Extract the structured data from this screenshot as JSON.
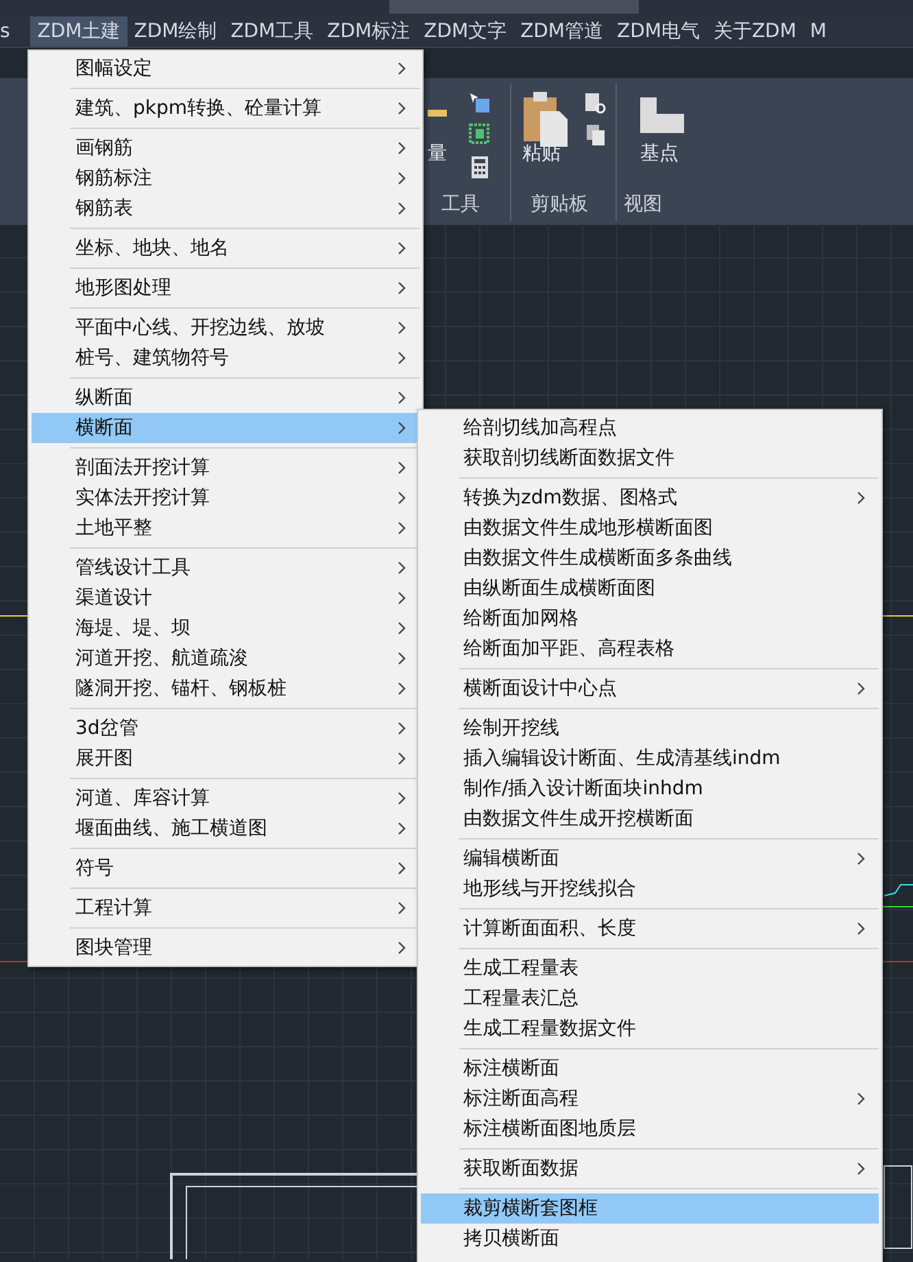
{
  "menu_bar": [
    {
      "label": "s",
      "selected": false
    },
    {
      "label": "ZDM土建",
      "selected": true
    },
    {
      "label": "ZDM绘制",
      "selected": false
    },
    {
      "label": "ZDM工具",
      "selected": false
    },
    {
      "label": "ZDM标注",
      "selected": false
    },
    {
      "label": "ZDM文字",
      "selected": false
    },
    {
      "label": "ZDM管道",
      "selected": false
    },
    {
      "label": "ZDM电气",
      "selected": false
    },
    {
      "label": "关于ZDM",
      "selected": false
    },
    {
      "label": "M",
      "selected": false
    }
  ],
  "ribbon": {
    "labels": [
      {
        "kind": "tool",
        "text": "量"
      },
      {
        "kind": "tool",
        "text": "粘贴"
      },
      {
        "kind": "tool",
        "text": "基点"
      },
      {
        "kind": "panel",
        "text": "工具"
      },
      {
        "kind": "panel",
        "text": "剪贴板"
      },
      {
        "kind": "panel",
        "text": "视图"
      }
    ]
  },
  "dropdown": {
    "groups": [
      {
        "items": [
          {
            "label": "图幅设定",
            "selected": false,
            "has_submenu": true
          }
        ]
      },
      {
        "items": [
          {
            "label": "建筑、pkpm转换、砼量计算",
            "selected": false,
            "has_submenu": true
          }
        ]
      },
      {
        "items": [
          {
            "label": "画钢筋",
            "selected": false,
            "has_submenu": true
          },
          {
            "label": "钢筋标注",
            "selected": false,
            "has_submenu": true
          },
          {
            "label": "钢筋表",
            "selected": false,
            "has_submenu": true
          }
        ]
      },
      {
        "items": [
          {
            "label": "坐标、地块、地名",
            "selected": false,
            "has_submenu": true
          }
        ]
      },
      {
        "items": [
          {
            "label": "地形图处理",
            "selected": false,
            "has_submenu": true
          }
        ]
      },
      {
        "items": [
          {
            "label": "平面中心线、开挖边线、放坡",
            "selected": false,
            "has_submenu": true
          },
          {
            "label": "桩号、建筑物符号",
            "selected": false,
            "has_submenu": true
          }
        ]
      },
      {
        "items": [
          {
            "label": "纵断面",
            "selected": false,
            "has_submenu": true
          },
          {
            "label": "横断面",
            "selected": true,
            "has_submenu": true
          }
        ]
      },
      {
        "items": [
          {
            "label": "剖面法开挖计算",
            "selected": false,
            "has_submenu": true
          },
          {
            "label": "实体法开挖计算",
            "selected": false,
            "has_submenu": true
          },
          {
            "label": "土地平整",
            "selected": false,
            "has_submenu": true
          }
        ]
      },
      {
        "items": [
          {
            "label": "管线设计工具",
            "selected": false,
            "has_submenu": true
          },
          {
            "label": "渠道设计",
            "selected": false,
            "has_submenu": true
          },
          {
            "label": "海堤、堤、坝",
            "selected": false,
            "has_submenu": true
          },
          {
            "label": "河道开挖、航道疏浚",
            "selected": false,
            "has_submenu": true
          },
          {
            "label": "隧洞开挖、锚杆、钢板桩",
            "selected": false,
            "has_submenu": true
          }
        ]
      },
      {
        "items": [
          {
            "label": "3d岔管",
            "selected": false,
            "has_submenu": true
          },
          {
            "label": "展开图",
            "selected": false,
            "has_submenu": true
          }
        ]
      },
      {
        "items": [
          {
            "label": "河道、库容计算",
            "selected": false,
            "has_submenu": true
          },
          {
            "label": "堰面曲线、施工横道图",
            "selected": false,
            "has_submenu": true
          }
        ]
      },
      {
        "items": [
          {
            "label": "符号",
            "selected": false,
            "has_submenu": true
          }
        ]
      },
      {
        "items": [
          {
            "label": "工程计算",
            "selected": false,
            "has_submenu": true
          }
        ]
      },
      {
        "items": [
          {
            "label": "图块管理",
            "selected": false,
            "has_submenu": true
          }
        ]
      }
    ]
  },
  "submenu": {
    "groups": [
      {
        "items": [
          {
            "label": "给剖切线加高程点",
            "selected": false,
            "has_submenu": false
          },
          {
            "label": "获取剖切线断面数据文件",
            "selected": false,
            "has_submenu": false
          }
        ]
      },
      {
        "items": [
          {
            "label": "转换为zdm数据、图格式",
            "selected": false,
            "has_submenu": true
          },
          {
            "label": "由数据文件生成地形横断面图",
            "selected": false,
            "has_submenu": false
          },
          {
            "label": "由数据文件生成横断面多条曲线",
            "selected": false,
            "has_submenu": false
          },
          {
            "label": "由纵断面生成横断面图",
            "selected": false,
            "has_submenu": false
          },
          {
            "label": "给断面加网格",
            "selected": false,
            "has_submenu": false
          },
          {
            "label": "给断面加平距、高程表格",
            "selected": false,
            "has_submenu": false
          }
        ]
      },
      {
        "items": [
          {
            "label": "横断面设计中心点",
            "selected": false,
            "has_submenu": true
          }
        ]
      },
      {
        "items": [
          {
            "label": "绘制开挖线",
            "selected": false,
            "has_submenu": false
          },
          {
            "label": "插入编辑设计断面、生成清基线indm",
            "selected": false,
            "has_submenu": false
          },
          {
            "label": "制作/插入设计断面块inhdm",
            "selected": false,
            "has_submenu": false
          },
          {
            "label": "由数据文件生成开挖横断面",
            "selected": false,
            "has_submenu": false
          }
        ]
      },
      {
        "items": [
          {
            "label": "编辑横断面",
            "selected": false,
            "has_submenu": true
          },
          {
            "label": "地形线与开挖线拟合",
            "selected": false,
            "has_submenu": false
          }
        ]
      },
      {
        "items": [
          {
            "label": "计算断面面积、长度",
            "selected": false,
            "has_submenu": true
          }
        ]
      },
      {
        "items": [
          {
            "label": "生成工程量表",
            "selected": false,
            "has_submenu": false
          },
          {
            "label": "工程量表汇总",
            "selected": false,
            "has_submenu": false
          },
          {
            "label": "生成工程量数据文件",
            "selected": false,
            "has_submenu": false
          }
        ]
      },
      {
        "items": [
          {
            "label": "标注横断面",
            "selected": false,
            "has_submenu": false
          },
          {
            "label": "标注断面高程",
            "selected": false,
            "has_submenu": true
          },
          {
            "label": "标注横断面图地质层",
            "selected": false,
            "has_submenu": false
          }
        ]
      },
      {
        "items": [
          {
            "label": "获取断面数据",
            "selected": false,
            "has_submenu": true
          }
        ]
      },
      {
        "items": [
          {
            "label": "裁剪横断套图框",
            "selected": true,
            "has_submenu": false
          },
          {
            "label": "拷贝横断面",
            "selected": false,
            "has_submenu": false
          }
        ]
      }
    ]
  }
}
